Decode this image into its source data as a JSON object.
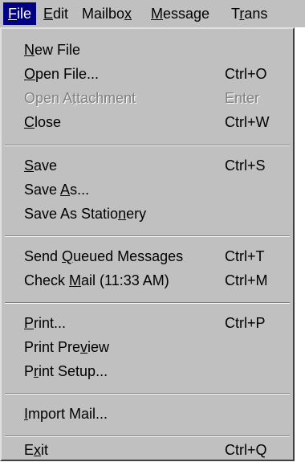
{
  "menubar": {
    "items": [
      {
        "pre": "",
        "key": "F",
        "post": "ile"
      },
      {
        "pre": "",
        "key": "E",
        "post": "dit"
      },
      {
        "pre": "Mailbo",
        "key": "x",
        "post": ""
      },
      {
        "pre": "",
        "key": "M",
        "post": "essage"
      },
      {
        "pre": "T",
        "key": "r",
        "post": "ans"
      }
    ]
  },
  "menu": {
    "items": [
      {
        "pre": "",
        "key": "N",
        "post": "ew File",
        "shortcut": ""
      },
      {
        "pre": "",
        "key": "O",
        "post": "pen File...",
        "shortcut": "Ctrl+O"
      },
      {
        "pre": "Open A",
        "key": "t",
        "post": "tachment",
        "shortcut": "Enter",
        "disabled": true
      },
      {
        "pre": "",
        "key": "C",
        "post": "lose",
        "shortcut": "Ctrl+W"
      },
      {
        "pre": "",
        "key": "S",
        "post": "ave",
        "shortcut": "Ctrl+S"
      },
      {
        "pre": "Save ",
        "key": "A",
        "post": "s...",
        "shortcut": ""
      },
      {
        "pre": "Save As Statio",
        "key": "n",
        "post": "ery",
        "shortcut": ""
      },
      {
        "pre": "Send ",
        "key": "Q",
        "post": "ueued Messages",
        "shortcut": "Ctrl+T"
      },
      {
        "pre": "Check ",
        "key": "M",
        "post": "ail (11:33 AM)",
        "shortcut": "Ctrl+M"
      },
      {
        "pre": "",
        "key": "P",
        "post": "rint...",
        "shortcut": "Ctrl+P"
      },
      {
        "pre": "Print Pre",
        "key": "v",
        "post": "iew",
        "shortcut": ""
      },
      {
        "pre": "P",
        "key": "r",
        "post": "int Setup...",
        "shortcut": ""
      },
      {
        "pre": "",
        "key": "I",
        "post": "mport Mail...",
        "shortcut": ""
      },
      {
        "pre": "E",
        "key": "x",
        "post": "it",
        "shortcut": "Ctrl+Q"
      }
    ]
  }
}
